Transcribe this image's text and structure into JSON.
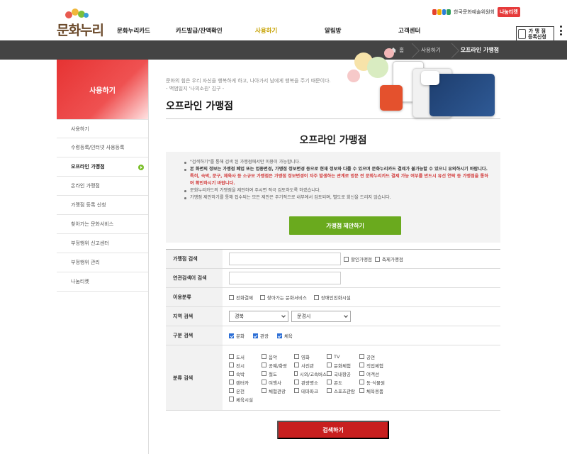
{
  "header": {
    "logo_text": "문화누리",
    "partner_name": "한국문화예술위원회",
    "partner_badge": "나눔티켓",
    "nav": [
      {
        "label": "문화누리카드",
        "active": false
      },
      {
        "label": "카드발급/잔액확인",
        "active": false
      },
      {
        "label": "사용하기",
        "active": true
      },
      {
        "label": "알림방",
        "active": false
      },
      {
        "label": "고객센터",
        "active": false
      }
    ],
    "store_register_line1": "가 맹 점",
    "store_register_line2": "등록신청",
    "accent_color": "#c6a100"
  },
  "breadcrumb": {
    "home": "홈",
    "level1": "사용하기",
    "current": "오프라인 가맹점"
  },
  "sidebar": {
    "title": "사용하기",
    "items": [
      {
        "label": "사용하기",
        "active": false
      },
      {
        "label": "수령등록/인터넷 사용등록",
        "active": false
      },
      {
        "label": "오프라인 가맹점",
        "active": true
      },
      {
        "label": "온라인 가맹점",
        "active": false
      },
      {
        "label": "가맹점 등록 신청",
        "active": false
      },
      {
        "label": "찾아가는 문화서비스",
        "active": false
      },
      {
        "label": "부정행위 신고센터",
        "active": false
      },
      {
        "label": "부정행위 관리",
        "active": false
      },
      {
        "label": "나눔티켓",
        "active": false
      }
    ]
  },
  "content": {
    "quote_line1": "문화의 힘은 우리 자신을 행복하게 하고, 나아가서 남에게 행복을 주기 때문이다.",
    "quote_line2": "- 백범일지 '나의소원' 김구 -",
    "page_title": "오프라인 가맹점",
    "section_title": "오프라인 가맹점"
  },
  "notice": {
    "line1": "\"검색하기\"를 통해 검색 된 가맹점에서만 이용이 가능합니다.",
    "line2_bold": "본 화면의 정보는 가맹점 폐업 또는 업종변경, 가맹점 정보변경 등으로 현재 정보와 다를 수 있으며 문화누리카드 결제가 불가능할 수 있으니 유의하시기 바랍니다.",
    "line2_red": "특히, 숙박, 문구, 체육사 등 소규모 가맹점은 가맹점 정보변경이 자주 발생하는 관계로 방문 전 문화누리카드 결제 가능 여부를 반드시 유선 연락 등 가맹점을 통하여 확인하시기 바랍니다.",
    "line3": "문화누리카드의 가맹점을 제안하여 주시면 적극 검토하도록 하겠습니다.",
    "line4": "가맹점 제안하기를 통해 접수되는 모든 제안은 주기적으로 내부에서 검토되며, 별도로 회신을 드리지 않습니다.",
    "propose_button": "가맹점 제안하기",
    "propose_color": "#6aaa1e"
  },
  "search": {
    "store_label": "가맹점 검색",
    "store_value": "",
    "discount_store": "할인가맹점",
    "festival_store": "축제가맹점",
    "related_label": "연관검색어 검색",
    "related_value": "",
    "use_label": "이용분류",
    "use_options": [
      "전화결제",
      "찾아가는 문화서비스",
      "장애인친화시설"
    ],
    "region_label": "지역 검색",
    "region_province": "경북",
    "region_city": "문경시",
    "type_label": "구분 검색",
    "type_options": [
      {
        "label": "문화",
        "checked": true
      },
      {
        "label": "관광",
        "checked": true
      },
      {
        "label": "체육",
        "checked": true
      }
    ],
    "category_label": "분류 검색",
    "categories": [
      "도서",
      "음악",
      "영화",
      "TV",
      "공연",
      "전시",
      "공예/화랑",
      "사진관",
      "문화체험",
      "직업체험",
      "숙박",
      "철도",
      "시외/고속버스",
      "국내항공",
      "여객선",
      "렌터카",
      "여행사",
      "관광명소",
      "콘도",
      "동·식물원",
      "온천",
      "체험관광",
      "테마파크",
      "스포츠관람",
      "체육용품",
      "체육시설"
    ],
    "search_button": "검색하기",
    "search_button_color": "#c81f1f"
  }
}
